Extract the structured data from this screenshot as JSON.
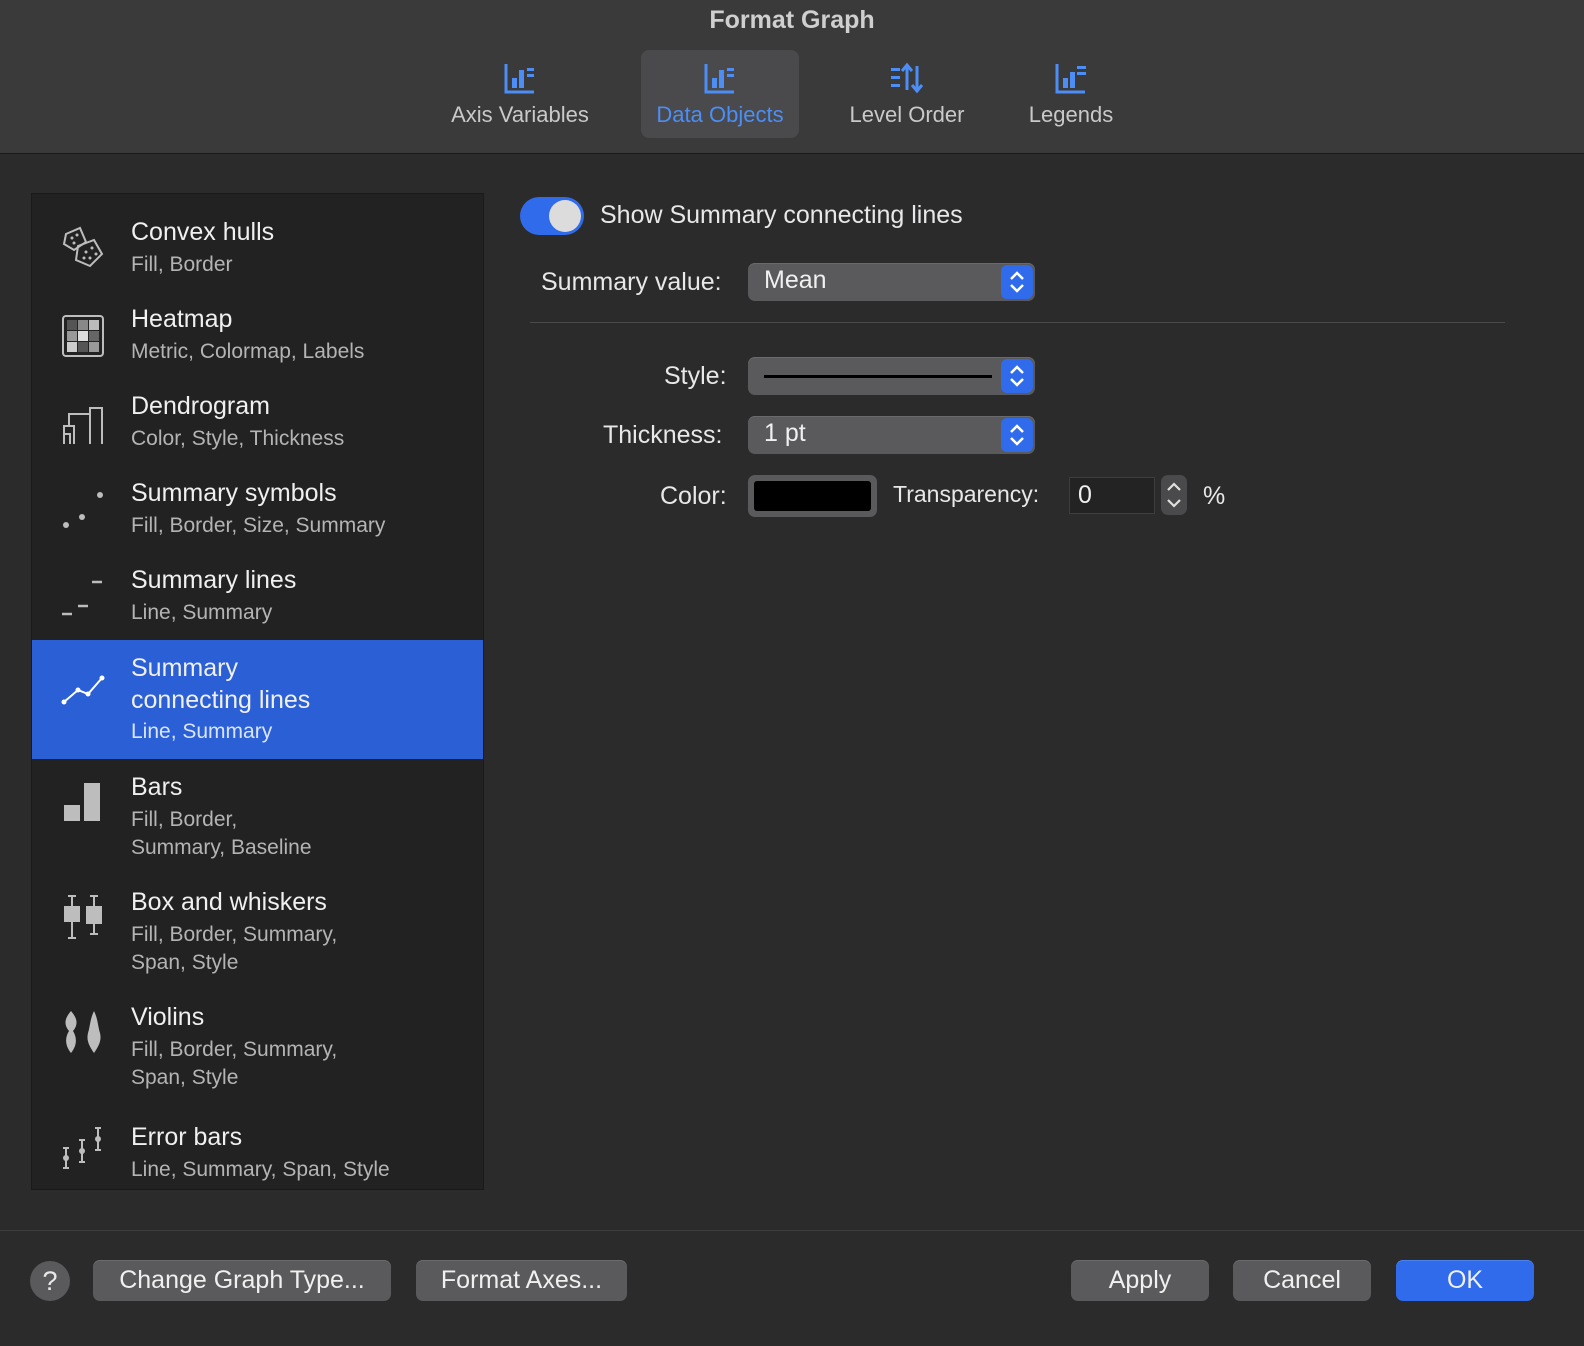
{
  "window": {
    "title": "Format Graph"
  },
  "tabs": [
    {
      "label": "Axis Variables",
      "icon": "axis-variables-icon"
    },
    {
      "label": "Data Objects",
      "icon": "data-objects-icon",
      "active": true
    },
    {
      "label": "Level Order",
      "icon": "level-order-icon"
    },
    {
      "label": "Legends",
      "icon": "legends-icon"
    }
  ],
  "sidebar": {
    "items": [
      {
        "title": "Convex hulls",
        "subtitle": "Fill, Border",
        "icon": "convex-hulls-icon"
      },
      {
        "title": "Heatmap",
        "subtitle": "Metric, Colormap, Labels",
        "icon": "heatmap-icon"
      },
      {
        "title": "Dendrogram",
        "subtitle": "Color, Style, Thickness",
        "icon": "dendrogram-icon"
      },
      {
        "title": "Summary symbols",
        "subtitle": "Fill, Border, Size, Summary",
        "icon": "summary-symbols-icon"
      },
      {
        "title": "Summary lines",
        "subtitle": "Line, Summary",
        "icon": "summary-lines-icon"
      },
      {
        "title_line1": "Summary",
        "title_line2": "connecting lines",
        "subtitle": "Line, Summary",
        "icon": "summary-connecting-lines-icon",
        "selected": true
      },
      {
        "title": "Bars",
        "subtitle_line1": "Fill, Border,",
        "subtitle_line2": "Summary, Baseline",
        "icon": "bars-icon"
      },
      {
        "title": "Box and whiskers",
        "subtitle_line1": "Fill, Border, Summary,",
        "subtitle_line2": "Span, Style",
        "icon": "box-whiskers-icon"
      },
      {
        "title": "Violins",
        "subtitle_line1": "Fill, Border, Summary,",
        "subtitle_line2": "Span, Style",
        "icon": "violins-icon"
      },
      {
        "title": "Error bars",
        "subtitle": "Line, Summary, Span, Style",
        "icon": "error-bars-icon"
      }
    ]
  },
  "panel": {
    "show_toggle_label": "Show Summary connecting lines",
    "show_toggle_on": true,
    "summary_value_label": "Summary value:",
    "summary_value": "Mean",
    "style_label": "Style:",
    "thickness_label": "Thickness:",
    "thickness_value": "1 pt",
    "color_label": "Color:",
    "color_value": "#000000",
    "transparency_label": "Transparency:",
    "transparency_value": "0",
    "transparency_unit": "%"
  },
  "footer": {
    "help": "?",
    "change_graph_type": "Change Graph Type...",
    "format_axes": "Format Axes...",
    "apply": "Apply",
    "cancel": "Cancel",
    "ok": "OK"
  },
  "colors": {
    "accent": "#2f6bea",
    "selection": "#2b5fd6",
    "active_tab_text": "#4c8ef5"
  }
}
